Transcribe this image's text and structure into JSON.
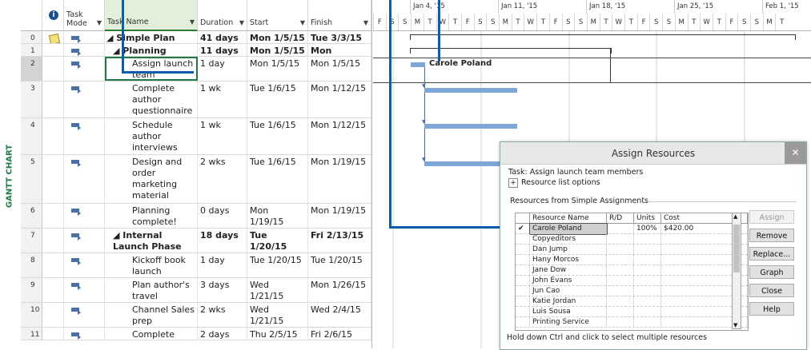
{
  "side_label": "GANTT CHART",
  "columns": {
    "indicator_icon": "info-icon",
    "mode": "Task Mode",
    "name": "Task Name",
    "duration": "Duration",
    "start": "Start",
    "finish": "Finish"
  },
  "rows": [
    {
      "id": "0",
      "name": "◢ Simple Plan",
      "duration": "41 days",
      "start": "Mon 1/5/15",
      "finish": "Tue 3/3/15",
      "bold": true
    },
    {
      "id": "1",
      "name": "◢ Planning Phase",
      "duration": "11 days",
      "start": "Mon 1/5/15",
      "finish": "Mon 1/19/15",
      "bold": true
    },
    {
      "id": "2",
      "name": "Assign launch team members",
      "duration": "1 day",
      "start": "Mon 1/5/15",
      "finish": "Mon 1/5/15"
    },
    {
      "id": "3",
      "name": "Complete author questionnaire",
      "duration": "1 wk",
      "start": "Tue 1/6/15",
      "finish": "Mon 1/12/15"
    },
    {
      "id": "4",
      "name": "Schedule author interviews",
      "duration": "1 wk",
      "start": "Tue 1/6/15",
      "finish": "Mon 1/12/15"
    },
    {
      "id": "5",
      "name": "Design and order marketing material",
      "duration": "2 wks",
      "start": "Tue 1/6/15",
      "finish": "Mon 1/19/15"
    },
    {
      "id": "6",
      "name": "Planning complete!",
      "duration": "0 days",
      "start": "Mon 1/19/15",
      "finish": "Mon 1/19/15"
    },
    {
      "id": "7",
      "name": "◢ Internal Launch Phase",
      "duration": "18 days",
      "start": "Tue 1/20/15",
      "finish": "Fri 2/13/15",
      "bold": true
    },
    {
      "id": "8",
      "name": "Kickoff book launch meeting",
      "duration": "1 day",
      "start": "Tue 1/20/15",
      "finish": "Tue 1/20/15"
    },
    {
      "id": "9",
      "name": "Plan author's travel itinerary",
      "duration": "3 days",
      "start": "Wed 1/21/15",
      "finish": "Mon 1/26/15"
    },
    {
      "id": "10",
      "name": "Channel Sales prep",
      "duration": "2 wks",
      "start": "Wed 1/21/15",
      "finish": "Wed 2/4/15"
    },
    {
      "id": "11",
      "name": "Complete book",
      "duration": "2 days",
      "start": "Thu 2/5/15",
      "finish": "Fri 2/6/15"
    }
  ],
  "timeline": {
    "weeks": [
      "Jan 4, '15",
      "Jan 11, '15",
      "Jan 18, '15",
      "Jan 25, '15",
      "Feb 1, '15"
    ],
    "days": [
      "F",
      "S",
      "S",
      "M",
      "T",
      "W",
      "T",
      "F",
      "S",
      "S",
      "M",
      "T",
      "W",
      "T",
      "F",
      "S",
      "S",
      "M",
      "T",
      "W",
      "T",
      "F",
      "S",
      "S",
      "M",
      "T",
      "W",
      "T",
      "F",
      "S",
      "S",
      "M",
      "T"
    ]
  },
  "gantt_resource_label": "Carole Poland",
  "dialog": {
    "title": "Assign Resources",
    "task_label": "Task: Assign launch team members",
    "options_label": "Resource list options",
    "resources_from": "Resources from Simple Assignments",
    "headers": {
      "name": "Resource Name",
      "rd": "R/D",
      "units": "Units",
      "cost": "Cost"
    },
    "resources": [
      {
        "check": "✔",
        "name": "Carole Poland",
        "units": "100%",
        "cost": "$420.00"
      },
      {
        "check": "",
        "name": "Copyeditors",
        "units": "",
        "cost": ""
      },
      {
        "check": "",
        "name": "Dan Jump",
        "units": "",
        "cost": ""
      },
      {
        "check": "",
        "name": "Hany Morcos",
        "units": "",
        "cost": ""
      },
      {
        "check": "",
        "name": "Jane Dow",
        "units": "",
        "cost": ""
      },
      {
        "check": "",
        "name": "John Evans",
        "units": "",
        "cost": ""
      },
      {
        "check": "",
        "name": "Jun Cao",
        "units": "",
        "cost": ""
      },
      {
        "check": "",
        "name": "Katie Jordan",
        "units": "",
        "cost": ""
      },
      {
        "check": "",
        "name": "Luis Sousa",
        "units": "",
        "cost": ""
      },
      {
        "check": "",
        "name": "Printing Service",
        "units": "",
        "cost": ""
      }
    ],
    "buttons": {
      "assign": "Assign",
      "remove": "Remove",
      "replace": "Replace...",
      "graph": "Graph",
      "close": "Close",
      "help": "Help"
    },
    "hint": "Hold down Ctrl and click to select multiple resources",
    "close_glyph": "✕",
    "plus_glyph": "+"
  }
}
